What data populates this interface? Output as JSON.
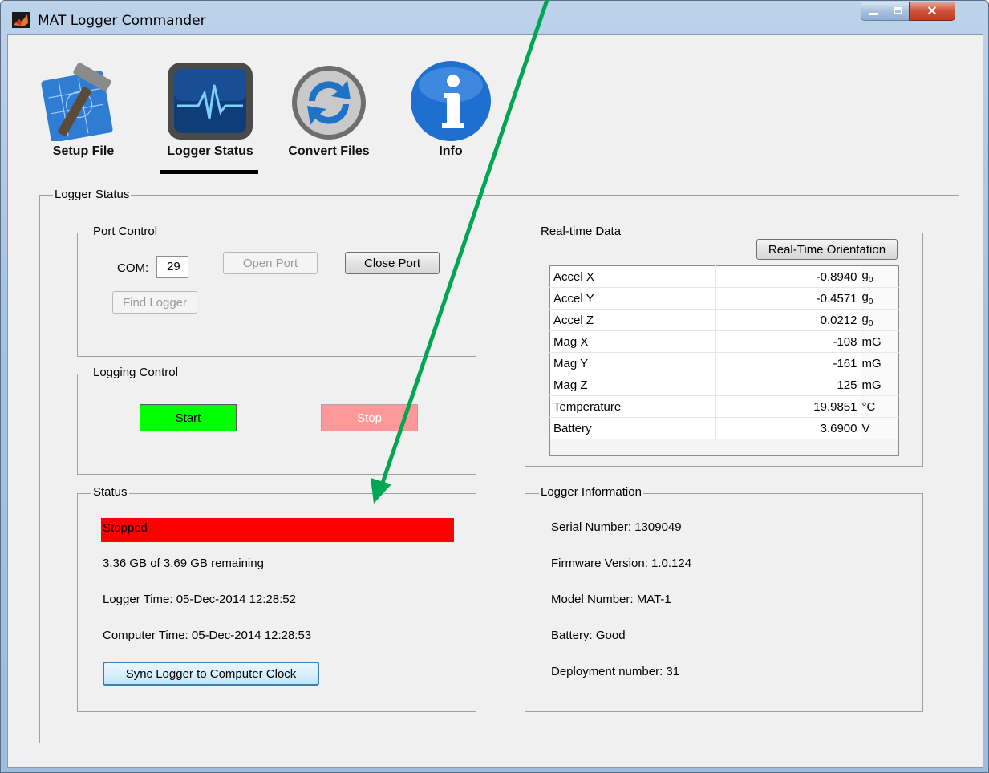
{
  "window": {
    "title": "MAT Logger Commander"
  },
  "titlebar_controls": [
    "minimize-icon",
    "maximize-icon",
    "close-icon"
  ],
  "toolbar": {
    "items": [
      {
        "label": "Setup File",
        "icon": "hammer-blueprint-icon"
      },
      {
        "label": "Logger Status",
        "icon": "heartbeat-monitor-icon",
        "selected": true
      },
      {
        "label": "Convert Files",
        "icon": "refresh-arrows-icon"
      },
      {
        "label": "Info",
        "icon": "info-icon"
      }
    ]
  },
  "main_group": {
    "title": "Logger Status"
  },
  "port_control": {
    "title": "Port Control",
    "com_label": "COM:",
    "com_value": "29",
    "open_port": "Open Port",
    "close_port": "Close Port",
    "find_logger": "Find Logger"
  },
  "logging_control": {
    "title": "Logging Control",
    "start": "Start",
    "stop": "Stop"
  },
  "status": {
    "title": "Status",
    "state": "Stopped",
    "storage": "3.36 GB of 3.69 GB remaining",
    "logger_time": "Logger Time: 05-Dec-2014 12:28:52",
    "computer_time": "Computer Time: 05-Dec-2014 12:28:53",
    "sync_button": "Sync Logger to Computer Clock"
  },
  "realtime": {
    "title": "Real-time Data",
    "orientation_button": "Real-Time Orientation",
    "rows": [
      {
        "name": "Accel X",
        "value": "-0.8940",
        "unit": "g0"
      },
      {
        "name": "Accel Y",
        "value": "-0.4571",
        "unit": "g0"
      },
      {
        "name": "Accel Z",
        "value": "0.0212",
        "unit": "g0"
      },
      {
        "name": "Mag X",
        "value": "-108",
        "unit": "mG"
      },
      {
        "name": "Mag Y",
        "value": "-161",
        "unit": "mG"
      },
      {
        "name": "Mag Z",
        "value": "125",
        "unit": "mG"
      },
      {
        "name": "Temperature",
        "value": "19.9851",
        "unit": "°C"
      },
      {
        "name": "Battery",
        "value": "3.6900",
        "unit": "V"
      }
    ]
  },
  "logger_info": {
    "title": "Logger Information",
    "serial": "Serial Number: 1309049",
    "firmware": "Firmware Version: 1.0.124",
    "model": "Model Number: MAT-1",
    "battery": "Battery: Good",
    "deployment": "Deployment number: 31"
  },
  "colors": {
    "start_button": "#00ff00",
    "stop_button": "#ff9999",
    "status_stopped": "#ff0000",
    "annotation_arrow": "#00a651"
  }
}
